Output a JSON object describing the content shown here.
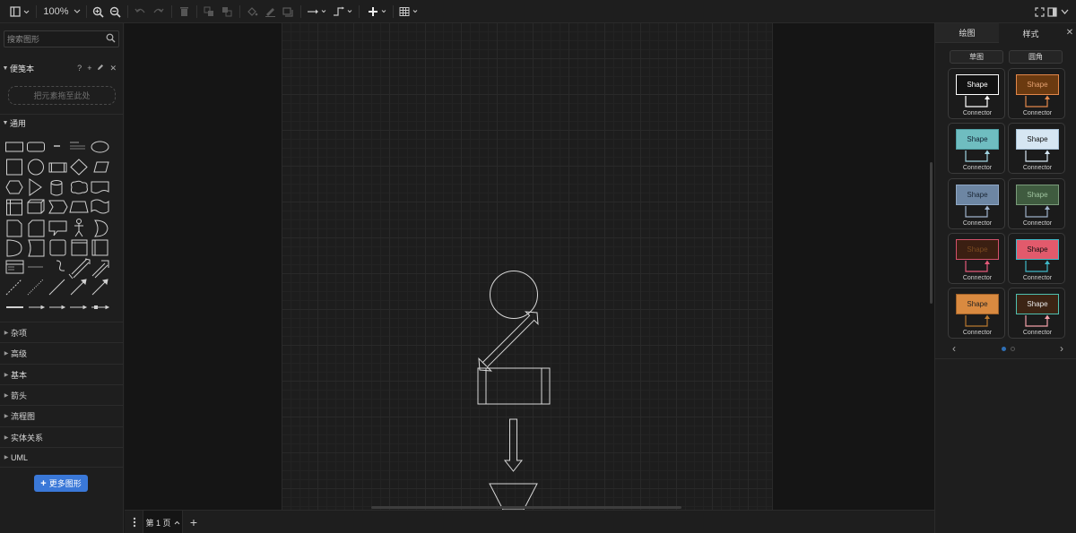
{
  "toolbar": {
    "zoom": "100%",
    "icons": [
      "view-icon",
      "zoom-in-icon",
      "zoom-out-icon",
      "undo-icon",
      "redo-icon",
      "delete-icon",
      "to-front-icon",
      "to-back-icon",
      "fill-color-icon",
      "line-color-icon",
      "shadow-icon",
      "connection-icon",
      "waypoints-icon",
      "insert-icon",
      "table-icon",
      "fullscreen-icon",
      "format-panel-icon",
      "collapse-icon"
    ]
  },
  "sidebar": {
    "search_placeholder": "搜索图形",
    "scratchpad": {
      "title": "便笺本",
      "help": "?",
      "dropzone": "把元素拖至此处"
    },
    "general_title": "通用",
    "collapsed_sections": [
      "杂项",
      "高级",
      "基本",
      "箭头",
      "流程图",
      "实体关系",
      "UML"
    ],
    "more_shapes": "更多图形"
  },
  "pagebar": {
    "page_label": "第 1 页"
  },
  "right_panel": {
    "tabs": [
      "绘图",
      "样式"
    ],
    "options": [
      "草图",
      "圆角"
    ],
    "style_cards": [
      {
        "shape": "Shape",
        "connector": "Connector",
        "fill": "#111111",
        "stroke": "#ffffff",
        "text": "#ffffff",
        "line": "#ffffff"
      },
      {
        "shape": "Shape",
        "connector": "Connector",
        "fill": "#6b3a10",
        "stroke": "#e3874a",
        "text": "#e3a070",
        "line": "#e3874a"
      },
      {
        "shape": "Shape",
        "connector": "Connector",
        "fill": "#6fbdc0",
        "stroke": "#4fa0a5",
        "text": "#123",
        "line": "#9fd3e0"
      },
      {
        "shape": "Shape",
        "connector": "Connector",
        "fill": "#d6e6f2",
        "stroke": "#a8c3d8",
        "text": "#111",
        "line": "#d6e6f2"
      },
      {
        "shape": "Shape",
        "connector": "Connector",
        "fill": "#6d86a3",
        "stroke": "#8fa7c4",
        "text": "#1b2735",
        "line": "#9fb2cc"
      },
      {
        "shape": "Shape",
        "connector": "Connector",
        "fill": "#3f5b3f",
        "stroke": "#7a9b7a",
        "text": "#9fc39f",
        "line": "#9db0c8"
      },
      {
        "shape": "Shape",
        "connector": "Connector",
        "fill": "#3b1f12",
        "stroke": "#d4506a",
        "text": "#7a4a20",
        "line": "#e55a7a"
      },
      {
        "shape": "Shape",
        "connector": "Connector",
        "fill": "#e25a6c",
        "stroke": "#3fb8c8",
        "text": "#111",
        "line": "#3fb8c8"
      },
      {
        "shape": "Shape",
        "connector": "Connector",
        "fill": "#d98a40",
        "stroke": "#a0622a",
        "text": "#222",
        "line": "#b8782f"
      },
      {
        "shape": "Shape",
        "connector": "Connector",
        "fill": "#3c2414",
        "stroke": "#4fc0b0",
        "text": "#e8e8e8",
        "line": "#f2a0a8"
      }
    ]
  }
}
